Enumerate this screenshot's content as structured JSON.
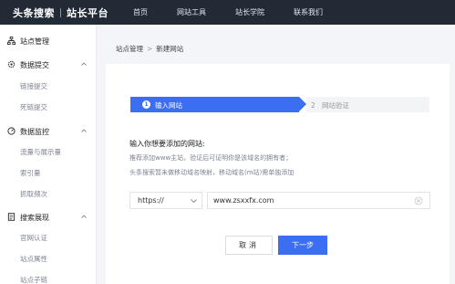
{
  "header": {
    "brand_name": "头条搜索",
    "brand_sub": "站长平台",
    "nav": [
      "首页",
      "网站工具",
      "站长学院",
      "联系我们"
    ]
  },
  "sidebar": {
    "groups": [
      {
        "label": "站点管理",
        "icon": "sitemap-icon",
        "items": []
      },
      {
        "label": "数据提交",
        "icon": "gear-icon",
        "items": [
          "链接提交",
          "死链提交"
        ]
      },
      {
        "label": "数据监控",
        "icon": "gauge-icon",
        "items": [
          "流量与展示量",
          "索引量",
          "抓取频次"
        ]
      },
      {
        "label": "搜索展现",
        "icon": "document-icon",
        "items": [
          "官网认证",
          "站点属性",
          "站点子链"
        ]
      }
    ]
  },
  "breadcrumb": {
    "parent": "站点管理",
    "separator": ">",
    "current": "新建网站"
  },
  "steps": [
    {
      "number": "1",
      "label": "输入网站",
      "active": true
    },
    {
      "number": "2",
      "label": "网站验证",
      "active": false
    }
  ],
  "form": {
    "question": "输入你想要添加的网站:",
    "description": [
      "推荐添加www主站，验证后可证明你是该域名的拥有者；",
      "头条搜索暂未做移动域名映射，移动域名(m站)需单独添加"
    ],
    "protocol": "https://",
    "url_value": "www.zsxxfx.com"
  },
  "buttons": {
    "cancel": "取消",
    "next": "下一步"
  },
  "colors": {
    "accent": "#3c6ef3",
    "topbar": "#222a36"
  }
}
